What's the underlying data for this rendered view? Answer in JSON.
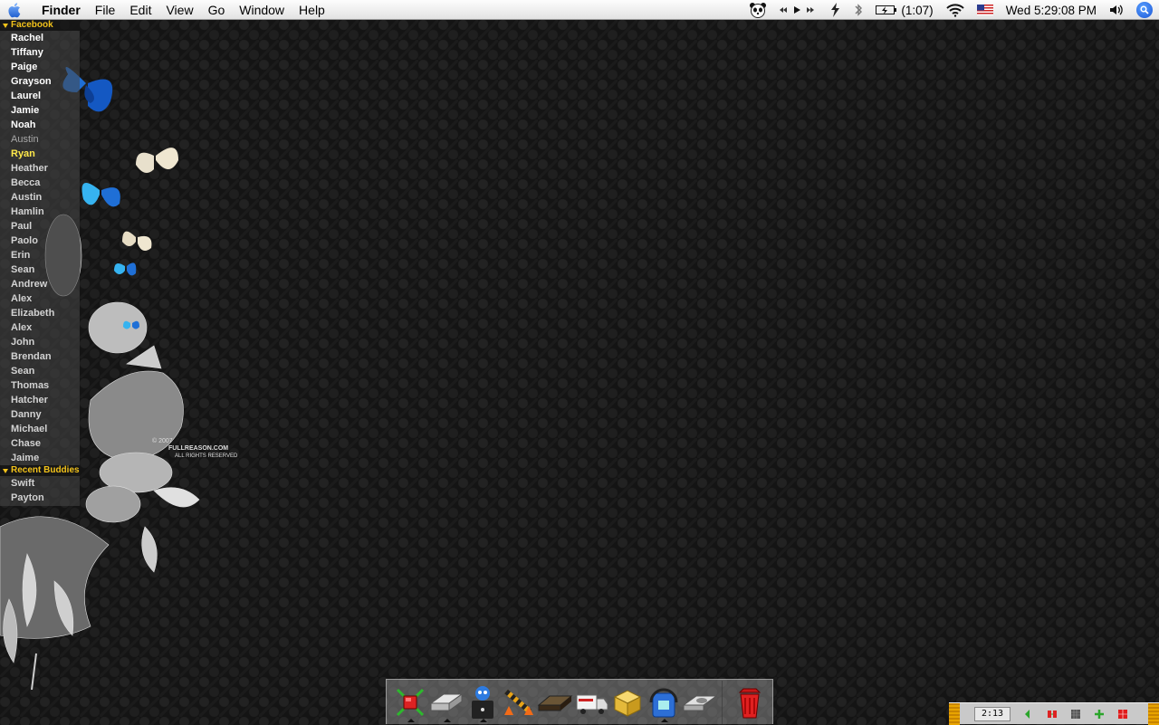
{
  "menubar": {
    "app_name": "Finder",
    "menus": [
      "File",
      "Edit",
      "View",
      "Go",
      "Window",
      "Help"
    ],
    "battery": "(1:07)",
    "clock": "Wed 5:29:08 PM"
  },
  "buddy_list": {
    "groups": [
      {
        "name": "Facebook",
        "buddies": [
          "Rachel",
          "Tiffany",
          "Paige",
          "Grayson",
          "Laurel",
          "Jamie",
          "Noah",
          "Austin",
          "Ryan",
          "Heather",
          "Becca",
          "Austin",
          "Hamlin",
          "Paul",
          "Paolo",
          "Erin",
          "Sean",
          "Andrew",
          "Alex",
          "Elizabeth",
          "Alex",
          "John",
          "Brendan",
          "Sean",
          "Thomas",
          "Hatcher",
          "Danny",
          "Michael",
          "Chase",
          "Jaime"
        ]
      },
      {
        "name": "Recent Buddies",
        "buddies": [
          "Swift",
          "Payton"
        ]
      }
    ]
  },
  "wallpaper": {
    "copyright_year": "© 2007",
    "copyright_site": "FULLREASON.COM",
    "copyright_rights": "ALL RIGHTS RESERVED"
  },
  "dock": {
    "items": [
      "network-utility-icon",
      "drive-icon",
      "adium-icon",
      "construction-icon",
      "vcr-icon",
      "delivery-truck-icon",
      "package-icon",
      "backup-icon",
      "scanner-icon",
      "trash-icon"
    ]
  },
  "status_strip": {
    "time": "2:13"
  },
  "colors": {
    "group_header": "#f2c21a",
    "idle_buddy": "#a8a8a8",
    "highlight_buddy": "#ffe94a"
  }
}
